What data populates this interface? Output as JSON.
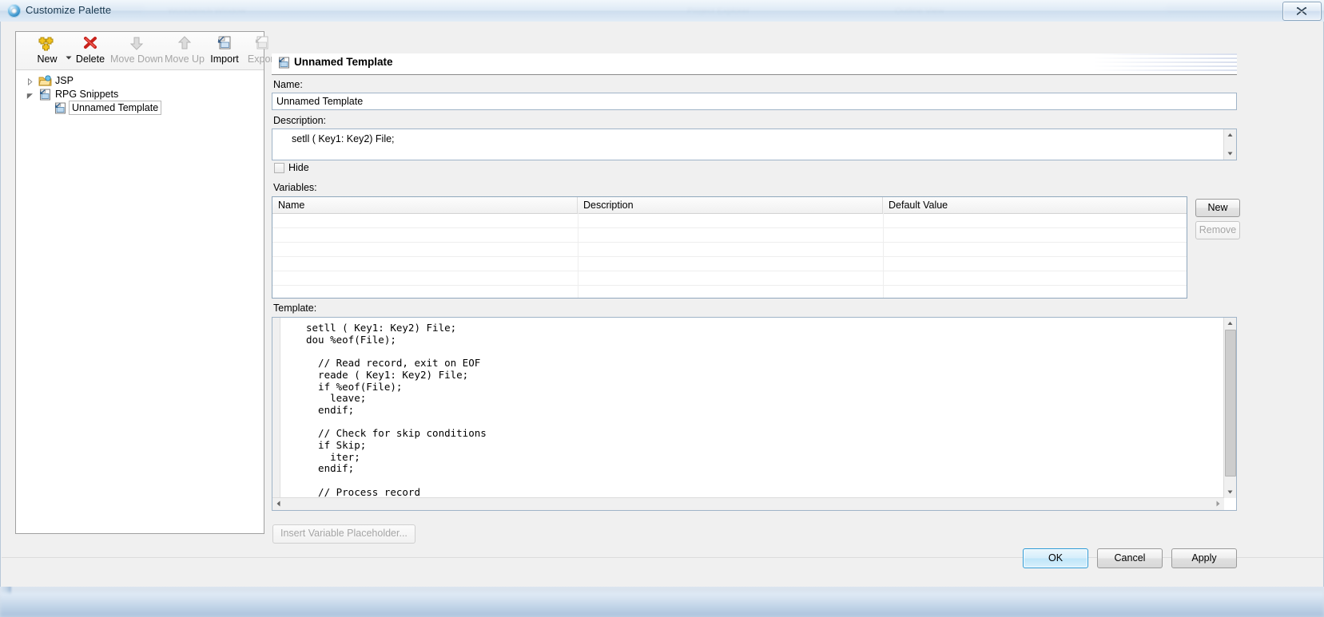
{
  "window": {
    "title": "Customize Palette",
    "icon": "palette-icon",
    "close_label": "x"
  },
  "toolbar": {
    "items": [
      {
        "label": "New",
        "icon": "new-icon",
        "enabled": true,
        "has_dropdown": true
      },
      {
        "label": "Delete",
        "icon": "delete-icon",
        "enabled": true,
        "has_dropdown": false
      },
      {
        "label": "Move Down",
        "icon": "arrow-down-icon",
        "enabled": false,
        "has_dropdown": false
      },
      {
        "label": "Move Up",
        "icon": "arrow-up-icon",
        "enabled": false,
        "has_dropdown": false
      },
      {
        "label": "Import",
        "icon": "import-icon",
        "enabled": true,
        "has_dropdown": false
      },
      {
        "label": "Export",
        "icon": "export-icon",
        "enabled": false,
        "has_dropdown": false
      }
    ]
  },
  "tree": {
    "nodes": [
      {
        "label": "JSP",
        "icon": "folder-icon",
        "expanded": false,
        "selected": false,
        "depth": 0
      },
      {
        "label": "RPG Snippets",
        "icon": "snippet-icon",
        "expanded": true,
        "selected": false,
        "depth": 0
      },
      {
        "label": "Unnamed Template",
        "icon": "template-icon",
        "expanded": null,
        "selected": true,
        "depth": 1
      }
    ]
  },
  "form": {
    "header_title": "Unnamed Template",
    "header_icon": "template-icon",
    "name_label": "Name:",
    "name_value": "Unnamed Template",
    "description_label": "Description:",
    "description_value": "setll ( Key1: Key2) File;",
    "hide_label": "Hide",
    "hide_checked": false,
    "variables_label": "Variables:",
    "template_label": "Template:"
  },
  "variables": {
    "columns": [
      "Name",
      "Description",
      "Default Value"
    ],
    "rows": [
      [
        "",
        "",
        ""
      ],
      [
        "",
        "",
        ""
      ],
      [
        "",
        "",
        ""
      ],
      [
        "",
        "",
        ""
      ],
      [
        "",
        "",
        ""
      ],
      [
        "",
        "",
        ""
      ]
    ],
    "new_label": "New",
    "remove_label": "Remove",
    "remove_enabled": false
  },
  "template_editor": {
    "code": "setll ( Key1: Key2) File;\ndou %eof(File);\n\n  // Read record, exit on EOF\n  reade ( Key1: Key2) File;\n  if %eof(File);\n    leave;\n  endif;\n\n  // Check for skip conditions\n  if Skip;\n    iter;\n  endif;\n\n  // Process record\n  process();",
    "insert_button_label": "Insert Variable Placeholder...",
    "insert_button_enabled": false
  },
  "footer": {
    "ok_label": "OK",
    "cancel_label": "Cancel",
    "apply_label": "Apply"
  },
  "colors": {
    "accent": "#2c9ad6",
    "dialog_bg": "#f0f0f0",
    "field_border": "#a0b4c8"
  }
}
